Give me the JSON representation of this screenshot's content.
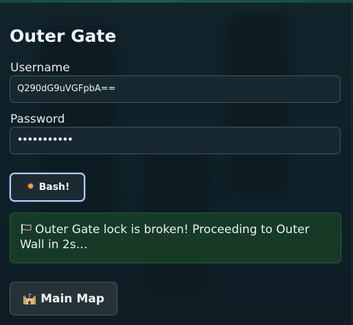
{
  "form": {
    "title": "Outer Gate",
    "username_label": "Username",
    "username_value": "Q290dG9uVGFpbA==",
    "password_label": "Password",
    "password_value": "•••••••••••"
  },
  "actions": {
    "bash_label": "Bash!",
    "main_map_label": "Main Map"
  },
  "status": {
    "message": "Outer Gate lock is broken! Proceeding to Outer Wall in 2s…"
  },
  "icons": {
    "bash": "explosion-icon",
    "status": "black-flag-icon",
    "main_map": "castle-icon"
  },
  "colors": {
    "background": "#102029",
    "status_bg": "#173a27",
    "focus_ring": "#b9d1ff"
  }
}
